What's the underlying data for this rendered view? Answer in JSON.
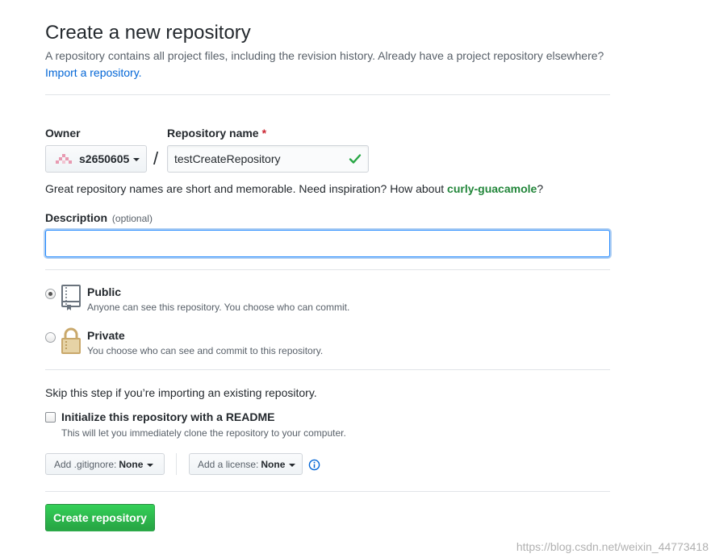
{
  "header": {
    "title": "Create a new repository",
    "subtitle": "A repository contains all project files, including the revision history. Already have a project repository elsewhere?",
    "import_link": "Import a repository."
  },
  "owner": {
    "label": "Owner",
    "value": "s2650605",
    "avatar": "identicon"
  },
  "repo_name": {
    "label": "Repository name",
    "required_mark": "*",
    "value": "testCreateRepository",
    "valid_icon": "check-icon"
  },
  "hint": {
    "prefix": "Great repository names are short and memorable. Need inspiration? How about ",
    "suggestion": "curly-guacamole",
    "suffix": "?"
  },
  "description": {
    "label": "Description",
    "optional": "(optional)",
    "value": ""
  },
  "visibility": {
    "selected": "public",
    "public": {
      "title": "Public",
      "note": "Anyone can see this repository. You choose who can commit.",
      "icon": "repo-book-icon"
    },
    "private": {
      "title": "Private",
      "note": "You choose who can see and commit to this repository.",
      "icon": "lock-icon"
    }
  },
  "init": {
    "skip_text": "Skip this step if you’re importing an existing repository.",
    "readme_label": "Initialize this repository with a README",
    "readme_note": "This will let you immediately clone the repository to your computer.",
    "readme_checked": false
  },
  "gitignore": {
    "label": "Add .gitignore:",
    "value": "None"
  },
  "license": {
    "label": "Add a license:",
    "value": "None"
  },
  "submit": {
    "label": "Create repository"
  },
  "watermark": "https://blog.csdn.net/weixin_44773418",
  "colors": {
    "primary_green": "#28a745",
    "link_blue": "#0366d6",
    "focus_blue": "#2188ff",
    "suggestion_green": "#22863a",
    "required_red": "#cb2431"
  }
}
